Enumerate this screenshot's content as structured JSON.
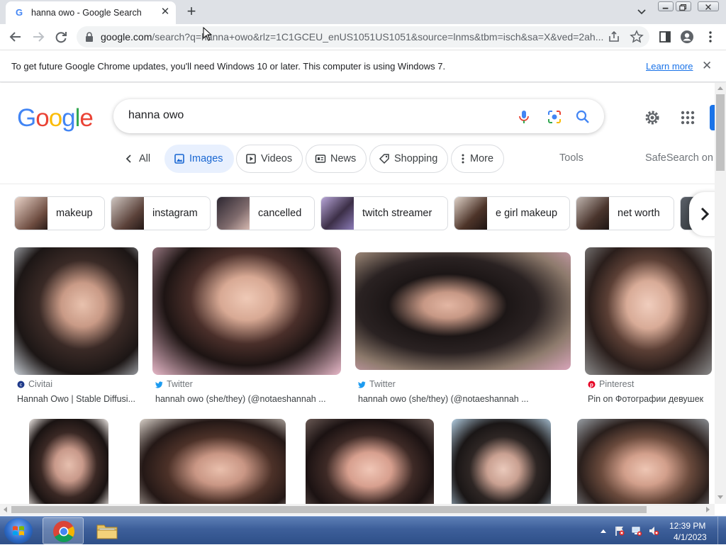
{
  "browser": {
    "tab_title": "hanna owo - Google Search",
    "url_host": "google.com",
    "url_path": "/search?q=hanna+owo&rlz=1C1GCEU_enUS1051US1051&source=lnms&tbm=isch&sa=X&ved=2ah..."
  },
  "infobar": {
    "message": "To get future Google Chrome updates, you'll need Windows 10 or later. This computer is using Windows 7.",
    "link": "Learn more"
  },
  "google": {
    "query": "hanna owo",
    "tabs": {
      "all": "All",
      "images": "Images",
      "videos": "Videos",
      "news": "News",
      "shopping": "Shopping",
      "more": "More"
    },
    "tools": "Tools",
    "safesearch": "SafeSearch on",
    "related": [
      {
        "label": "makeup"
      },
      {
        "label": "instagram"
      },
      {
        "label": "cancelled"
      },
      {
        "label": "twitch streamer"
      },
      {
        "label": "e girl makeup"
      },
      {
        "label": "net worth"
      }
    ],
    "results": [
      {
        "source": "Civitai",
        "caption": "Hannah Owo | Stable Diffusi..."
      },
      {
        "source": "Twitter",
        "caption": "hannah owo (she/they) (@notaeshannah ..."
      },
      {
        "source": "Twitter",
        "caption": "hannah owo (she/they) (@notaeshannah ..."
      },
      {
        "source": "Pinterest",
        "caption": "Pin on Фотографии девушек"
      }
    ]
  },
  "taskbar": {
    "time": "12:39 PM",
    "date": "4/1/2023"
  },
  "colors": {
    "accent": "#1a73e8",
    "images_tab_bg": "#e8f0fe",
    "taskbar": "#3d5f9a"
  }
}
